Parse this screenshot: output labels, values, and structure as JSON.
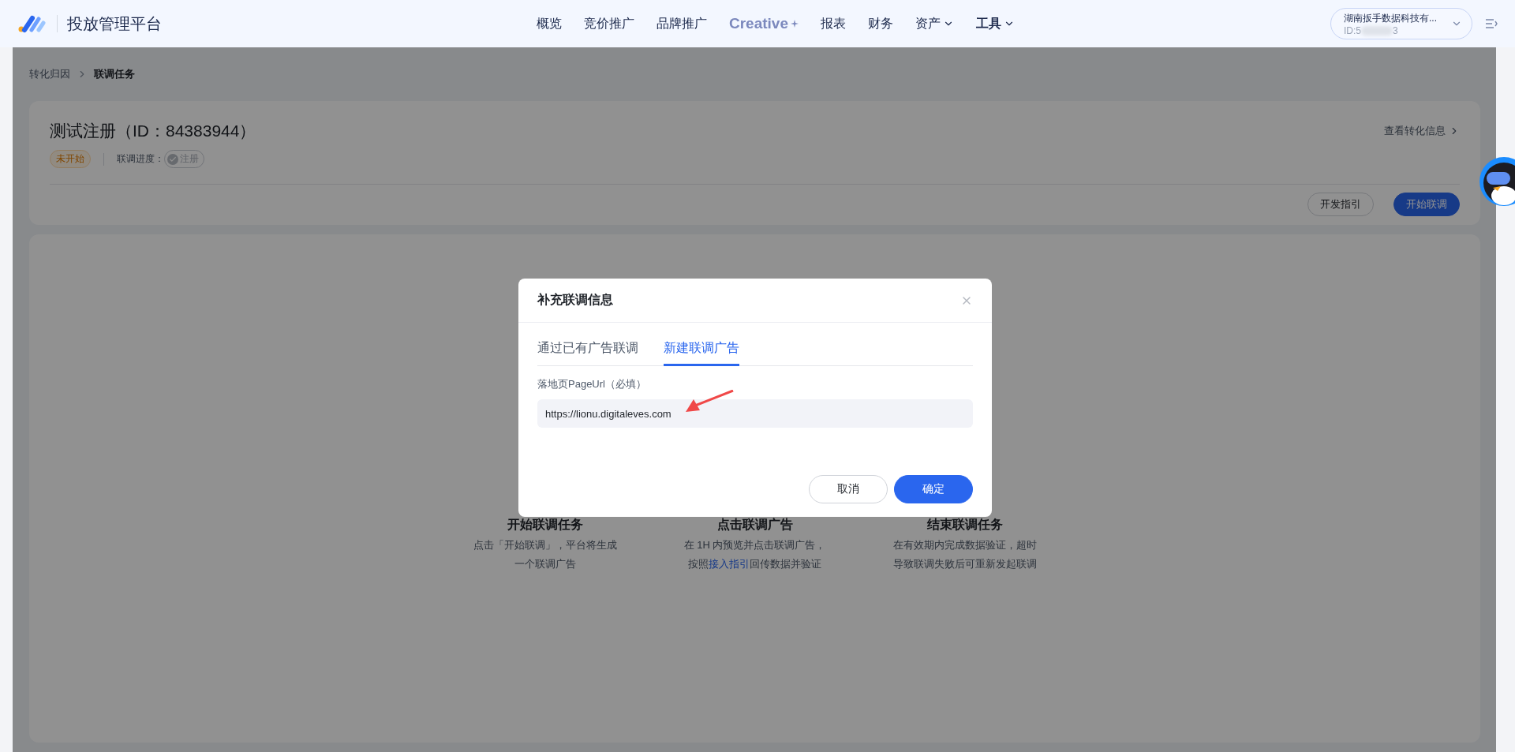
{
  "nav": {
    "title": "投放管理平台",
    "menu": [
      {
        "label": "概览",
        "kind": "text",
        "dropdown": false,
        "selected": false
      },
      {
        "label": "竞价推广",
        "kind": "text",
        "dropdown": false,
        "selected": false
      },
      {
        "label": "品牌推广",
        "kind": "text",
        "dropdown": false,
        "selected": false
      },
      {
        "label": "Creative",
        "kind": "brand",
        "dropdown": false,
        "selected": false
      },
      {
        "label": "报表",
        "kind": "text",
        "dropdown": false,
        "selected": false
      },
      {
        "label": "财务",
        "kind": "text",
        "dropdown": false,
        "selected": false
      },
      {
        "label": "资产",
        "kind": "text",
        "dropdown": true,
        "selected": false
      },
      {
        "label": "工具",
        "kind": "text",
        "dropdown": true,
        "selected": true
      }
    ],
    "account": {
      "name": "湖南扳手数据科技有...",
      "id_prefix": "ID:5",
      "id_suffix": "3"
    }
  },
  "breadcrumb": [
    {
      "label": "转化归因",
      "current": false
    },
    {
      "label": "联调任务",
      "current": true
    }
  ],
  "task": {
    "title": "测试注册（ID：84383944）",
    "status": "未开始",
    "progress_label": "联调进度：",
    "progress_steps": [
      {
        "label": "注册",
        "done": false
      }
    ],
    "info_link": "查看转化信息",
    "buttons": [
      {
        "label": "开发指引",
        "kind": "secondary"
      },
      {
        "label": "开始联调",
        "kind": "primary"
      }
    ]
  },
  "steps": [
    {
      "title": "开始联调任务",
      "lines": [
        {
          "text": "点击「开始联调」，平台将生成"
        },
        {
          "text": "一个联调广告"
        }
      ]
    },
    {
      "title": "点击联调广告",
      "lines": [
        {
          "text": "在 1H 内预览并点击联调广告，"
        },
        {
          "text": "按照",
          "link": "接入指引",
          "after": "回传数据并验证"
        }
      ]
    },
    {
      "title": "结束联调任务",
      "lines": [
        {
          "text": "在有效期内完成数据验证，超时"
        },
        {
          "text": "导致联调失败后可重新发起联调"
        }
      ]
    }
  ],
  "modal": {
    "title": "补充联调信息",
    "tabs": [
      {
        "label": "通过已有广告联调",
        "selected": false
      },
      {
        "label": "新建联调广告",
        "selected": true
      }
    ],
    "field": {
      "label": "落地页PageUrl（必填）",
      "value": "https://lionu.digitaleves.com"
    },
    "buttons": [
      {
        "label": "取消",
        "kind": "secondary"
      },
      {
        "label": "确定",
        "kind": "primary"
      }
    ]
  }
}
